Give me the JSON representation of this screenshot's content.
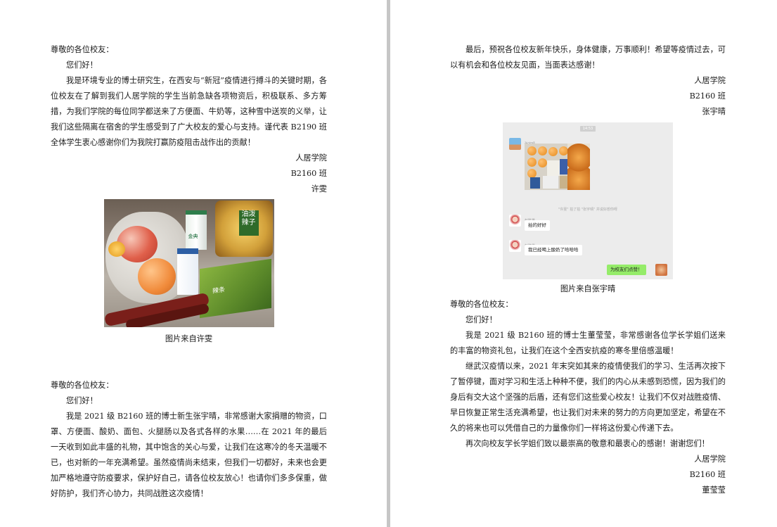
{
  "left": {
    "letter1": {
      "salutation": "尊敬的各位校友：",
      "greeting": "您们好！",
      "body": "我是环境专业的博士研究生，在西安与“新冠”疫情进行搏斗的关键时期，各位校友在了解到我们人居学院的学生当前急缺各项物资后，积极联系、多方筹措，为我们学院的每位同学都送来了方便面、牛奶等，这种雪中送炭的义举，让我们这些隔离在宿舍的学生感受到了广大校友的爱心与支持。谨代表 B2190 班全体学生衷心感谢你们为我院打赢防疫阻击战作出的贡献！",
      "sign_school": "人居学院",
      "sign_class": "B2160 班",
      "sign_name": "许雯",
      "photo_labels": {
        "milk": "金典",
        "noodle": "油泼辣子",
        "box": "辣条"
      },
      "caption": "图片来自许雯"
    },
    "letter2": {
      "salutation": "尊敬的各位校友：",
      "greeting": "您们好！",
      "body": "我是 2021 级 B2160 班的博士新生张宇晴，非常感谢大家捐赠的物资，口罩、方便面、酸奶、面包、火腿肠以及各式各样的水果……在 2021 年的最后一天收到如此丰盛的礼物，其中饱含的关心与爱，让我们在这寒冷的冬天温暖不已，也对新的一年充满希望。虽然疫情尚未结束，但我们一切都好，未来也会更加严格地遵守防疫要求，保护好自己，请各位校友放心！也请你们多多保重，做好防护，我们齐心协力，共同战胜这次疫情！"
    }
  },
  "right": {
    "letter2_end": {
      "body": "最后，预祝各位校友新年快乐，身体健康，万事顺利！希望等疫情过去，可以有机会和各位校友见面，当面表达感谢！",
      "sign_school": "人居学院",
      "sign_class": "B2160 班",
      "sign_name": "张宇晴"
    },
    "chat": {
      "time": "14:53",
      "sender1": "张宇晴",
      "system_msg": "\"许雯\" 拍了拍 \"张宇晴\" 并说好想你呀",
      "sender2": "赵胜男",
      "msg1": "拍的好好",
      "sender3": "赵胜男",
      "msg2": "我已经喝上酸奶了哈哈哈",
      "msg3": "为校友们点赞！"
    },
    "caption": "图片来自张宇晴",
    "letter3": {
      "salutation": "尊敬的各位校友：",
      "greeting": "您们好！",
      "para1": "我是 2021 级 B2160 班的博士生董莹莹，非常感谢各位学长学姐们送来的丰富的物资礼包，让我们在这个全西安抗疫的寒冬里倍感温暖！",
      "para2": "继武汉疫情以来，2021 年末突如其来的疫情使我们的学习、生活再次按下了暂停键，面对学习和生活上种种不便，我们的内心从未感到恐慌，因为我们的身后有交大这个坚强的后盾，还有您们这些爱心校友！让我们不仅对战胜疫情、早日恢复正常生活充满希望，也让我们对未来的努力的方向更加坚定，希望在不久的将来也可以凭借自己的力量像你们一样将这份爱心传递下去。",
      "para3": "再次向校友学长学姐们致以最崇高的敬意和最衷心的感谢！谢谢您们！",
      "sign_school": "人居学院",
      "sign_class": "B2160 班",
      "sign_name": "董莹莹"
    }
  },
  "colors": {
    "page": "#ffffff",
    "background": "#c6c6c6",
    "text": "#1a1a1a",
    "chat_green": "#95ec69"
  }
}
